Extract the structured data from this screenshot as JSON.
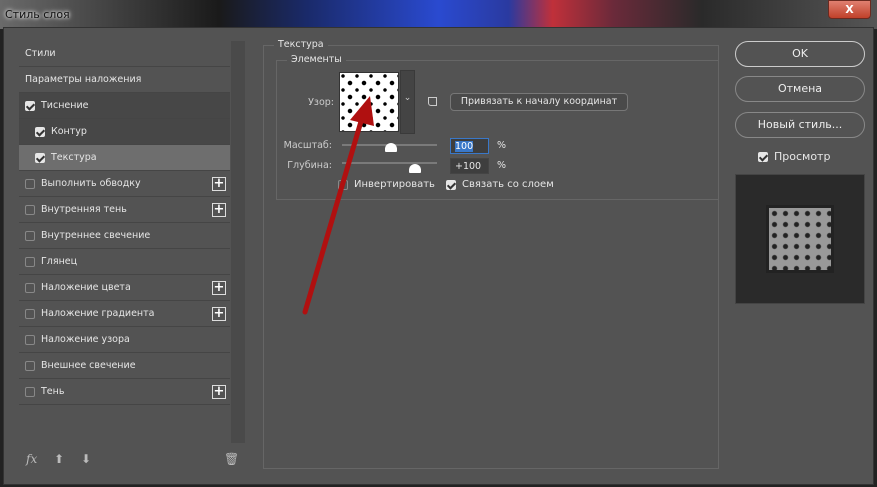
{
  "window": {
    "title": "Стиль слоя",
    "close": "X"
  },
  "sidebar": {
    "items": [
      {
        "label": "Стили",
        "checkbox": null,
        "plus": false
      },
      {
        "label": "Параметры наложения",
        "checkbox": null,
        "plus": false
      },
      {
        "label": "Тиснение",
        "checkbox": true,
        "plus": false
      },
      {
        "label": "Контур",
        "checkbox": true,
        "plus": false
      },
      {
        "label": "Текстура",
        "checkbox": true,
        "plus": false,
        "selected": true
      },
      {
        "label": "Выполнить обводку",
        "checkbox": false,
        "plus": true
      },
      {
        "label": "Внутренняя тень",
        "checkbox": false,
        "plus": true
      },
      {
        "label": "Внутреннее свечение",
        "checkbox": false,
        "plus": false
      },
      {
        "label": "Глянец",
        "checkbox": false,
        "plus": false
      },
      {
        "label": "Наложение цвета",
        "checkbox": false,
        "plus": true
      },
      {
        "label": "Наложение градиента",
        "checkbox": false,
        "plus": true
      },
      {
        "label": "Наложение узора",
        "checkbox": false,
        "plus": false
      },
      {
        "label": "Внешнее свечение",
        "checkbox": false,
        "plus": false
      },
      {
        "label": "Тень",
        "checkbox": false,
        "plus": true
      }
    ],
    "fx": "fx"
  },
  "texture": {
    "section": "Текстура",
    "group": "Элементы",
    "pattern_label": "Узор:",
    "snap_button": "Привязать к началу координат",
    "scale_label": "Масштаб:",
    "scale_value": "100",
    "scale_unit": "%",
    "scale_pct": 100,
    "depth_label": "Глубина:",
    "depth_value": "+100",
    "depth_unit": "%",
    "depth_pct": 100,
    "invert_label": "Инвертировать",
    "invert": false,
    "link_label": "Связать со слоем",
    "link": true
  },
  "actions": {
    "ok": "OK",
    "cancel": "Отмена",
    "new_style": "Новый стиль...",
    "preview_label": "Просмотр",
    "preview": true
  },
  "colors": {
    "accent_arrow": "#b01010",
    "selection": "#3a78c8"
  }
}
